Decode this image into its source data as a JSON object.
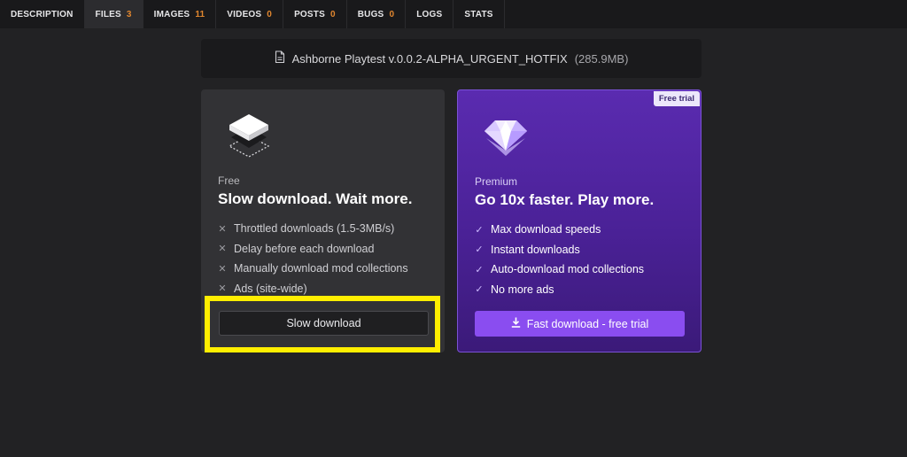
{
  "tabs": [
    {
      "label": "DESCRIPTION",
      "count": ""
    },
    {
      "label": "FILES",
      "count": "3"
    },
    {
      "label": "IMAGES",
      "count": "11"
    },
    {
      "label": "VIDEOS",
      "count": "0"
    },
    {
      "label": "POSTS",
      "count": "0"
    },
    {
      "label": "BUGS",
      "count": "0"
    },
    {
      "label": "LOGS",
      "count": ""
    },
    {
      "label": "STATS",
      "count": ""
    }
  ],
  "file": {
    "name": "Ashborne Playtest v.0.0.2-ALPHA_URGENT_HOTFIX",
    "size": "(285.9MB)",
    "icon": "file-icon"
  },
  "free": {
    "kicker": "Free",
    "title": "Slow download. Wait more.",
    "features": [
      "Throttled downloads (1.5-3MB/s)",
      "Delay before each download",
      "Manually download mod collections",
      "Ads (site-wide)"
    ],
    "button_label": "Slow download",
    "icon": "layers-icon"
  },
  "premium": {
    "badge": "Free trial",
    "kicker": "Premium",
    "title": "Go 10x faster. Play more.",
    "features": [
      "Max download speeds",
      "Instant downloads",
      "Auto-download mod collections",
      "No more ads"
    ],
    "button_label": "Fast download - free trial",
    "icon": "diamond-icon"
  },
  "colors": {
    "accent_orange": "#e0862f",
    "premium_purple": "#8a4df0",
    "highlight_yellow": "#ffee00"
  }
}
